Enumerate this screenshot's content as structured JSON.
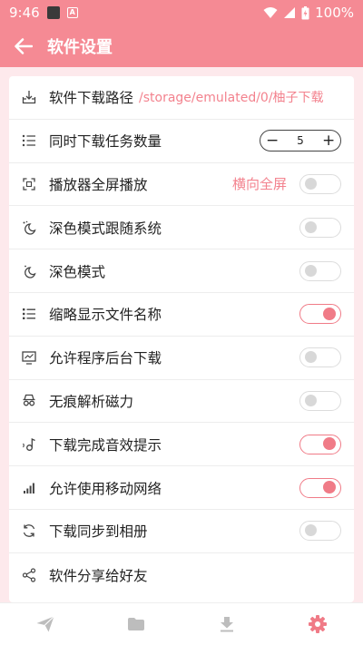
{
  "status_bar": {
    "time": "9:46",
    "a_badge": "A",
    "battery": "100%"
  },
  "app_bar": {
    "title": "软件设置"
  },
  "settings": {
    "download_path": {
      "label": "软件下载路径",
      "value": "/storage/emulated/0/柚子下载"
    },
    "concurrent": {
      "label": "同时下载任务数量",
      "value": "5",
      "minus": "−",
      "plus": "+"
    },
    "fullscreen": {
      "label": "播放器全屏播放",
      "mode": "横向全屏",
      "enabled": false
    },
    "dark_follow": {
      "label": "深色模式跟随系统",
      "enabled": false
    },
    "dark_mode": {
      "label": "深色模式",
      "enabled": false
    },
    "abbrev_name": {
      "label": "缩略显示文件名称",
      "enabled": true
    },
    "background_dl": {
      "label": "允许程序后台下载",
      "enabled": false
    },
    "no_trace": {
      "label": "无痕解析磁力",
      "enabled": false
    },
    "done_sound": {
      "label": "下载完成音效提示",
      "enabled": true
    },
    "mobile_net": {
      "label": "允许使用移动网络",
      "enabled": true
    },
    "sync_album": {
      "label": "下载同步到相册",
      "enabled": false
    },
    "share": {
      "label": "软件分享给好友"
    }
  },
  "colors": {
    "primary": "#f58a94",
    "accent": "#f07b87",
    "inactive_nav": "#bdbdbd"
  },
  "bottom_nav": {
    "items": [
      {
        "icon": "send-icon",
        "active": false
      },
      {
        "icon": "folder-icon",
        "active": false
      },
      {
        "icon": "download-icon",
        "active": false
      },
      {
        "icon": "settings-gear-icon",
        "active": true
      }
    ]
  }
}
